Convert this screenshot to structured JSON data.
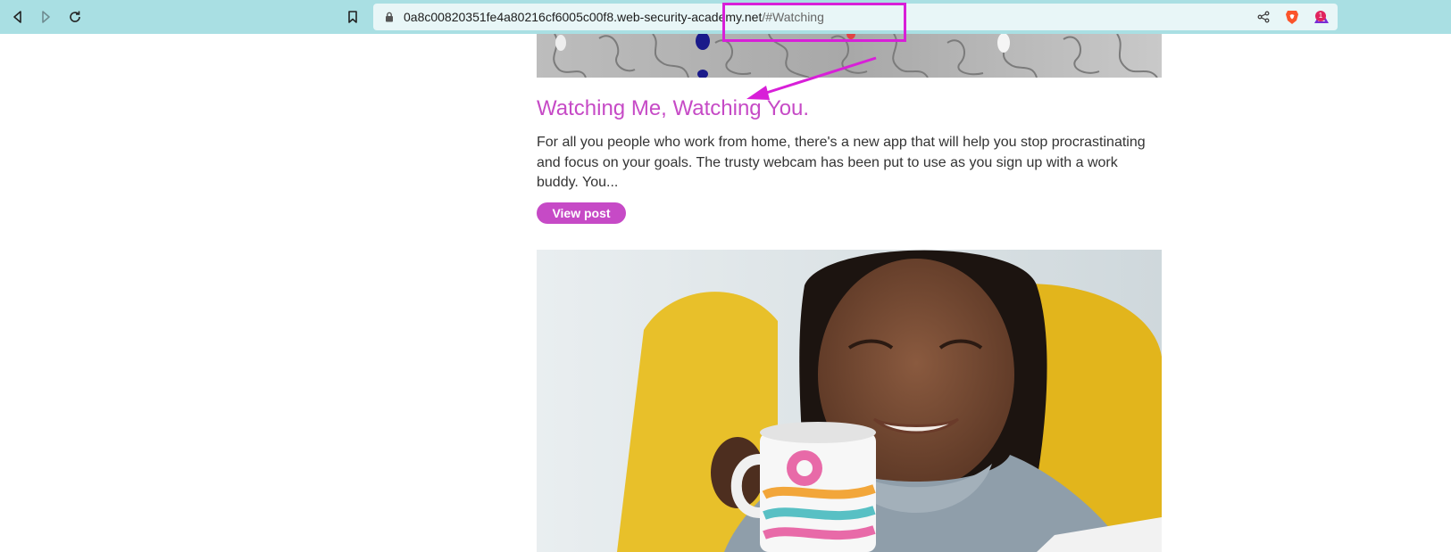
{
  "browser": {
    "url_main": "0a8c00820351fe4a80216cf6005c00f8.web-security-academy.net",
    "url_fragment": "/#Watching",
    "icons": {
      "back": "back-arrow-icon",
      "forward": "forward-arrow-icon",
      "reload": "reload-icon",
      "bookmark": "bookmark-icon",
      "lock": "lock-icon",
      "share": "share-icon",
      "brave": "brave-shield-icon",
      "rewards": "brave-rewards-icon"
    },
    "rewards_badge": "1",
    "colors": {
      "toolbar": "#a9dfe3",
      "urlbar": "#e8f6f7"
    }
  },
  "annotation": {
    "color": "#d81fd8"
  },
  "post": {
    "title": "Watching Me, Watching You.",
    "excerpt": "For all you people who work from home, there's a new app that will help you stop procrastinating and focus on your goals. The trusty webcam has been put to use as you sign up with a work buddy. You...",
    "button_label": "View post",
    "accent_color": "#c64ac6"
  }
}
